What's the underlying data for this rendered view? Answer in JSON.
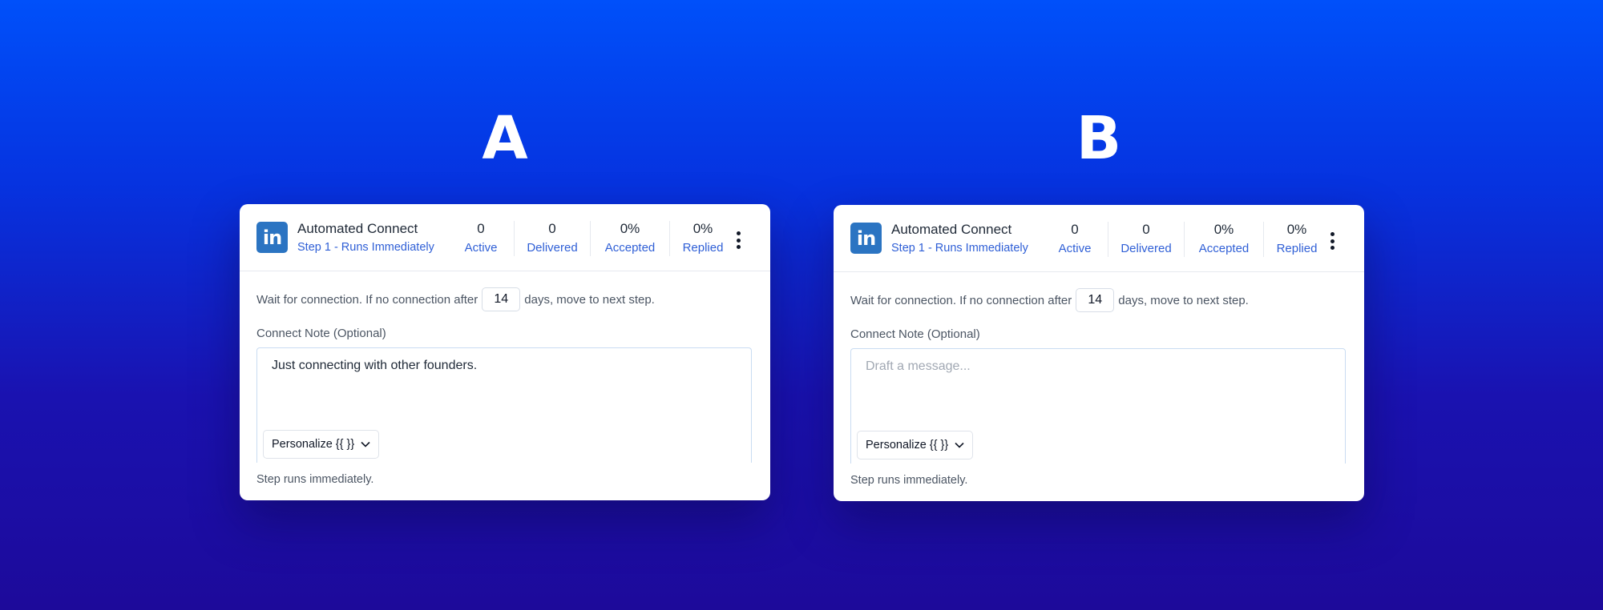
{
  "labels": {
    "a": "A",
    "b": "B"
  },
  "cards": [
    {
      "logo_text": "in",
      "title": "Automated Connect",
      "subtitle": "Step 1 - Runs Immediately",
      "stats": [
        {
          "value": "0",
          "label": "Active"
        },
        {
          "value": "0",
          "label": "Delivered"
        },
        {
          "value": "0%",
          "label": "Accepted"
        },
        {
          "value": "0%",
          "label": "Replied"
        }
      ],
      "wait_prefix": "Wait for connection. If no connection after",
      "days_value": "14",
      "wait_suffix": "days, move to next step.",
      "note_label": "Connect Note (Optional)",
      "note_value": "Just connecting with other founders.",
      "personalize_label": "Personalize {{ }}",
      "footer_note": "Step runs immediately."
    },
    {
      "logo_text": "in",
      "title": "Automated Connect",
      "subtitle": "Step 1 - Runs Immediately",
      "stats": [
        {
          "value": "0",
          "label": "Active"
        },
        {
          "value": "0",
          "label": "Delivered"
        },
        {
          "value": "0%",
          "label": "Accepted"
        },
        {
          "value": "0%",
          "label": "Replied"
        }
      ],
      "wait_prefix": "Wait for connection. If no connection after",
      "days_value": "14",
      "wait_suffix": "days, move to next step.",
      "note_label": "Connect Note (Optional)",
      "note_placeholder": "Draft a message...",
      "personalize_label": "Personalize {{ }}",
      "footer_note": "Step runs immediately."
    }
  ],
  "colors": {
    "linkedin": "#2b74c2",
    "link_blue": "#2f5fd6",
    "background_top": "#0050fa",
    "background_bottom": "#1d0a9a"
  },
  "icons": {
    "menu": "kebab-menu-icon",
    "dropdown": "chevron-down-icon",
    "brand": "linkedin-icon"
  }
}
